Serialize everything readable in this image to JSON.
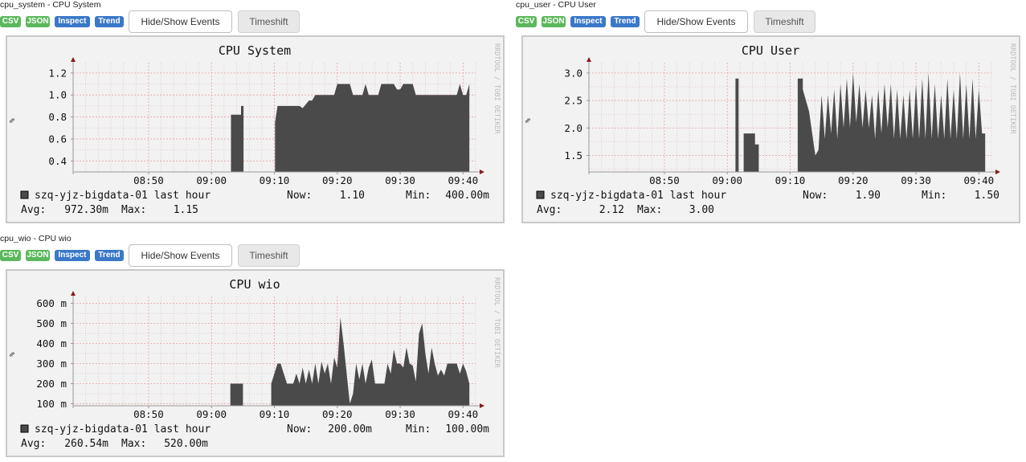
{
  "panels": [
    {
      "header": "cpu_system - CPU System",
      "buttons": {
        "csv": "CSV",
        "json": "JSON",
        "inspect": "Inspect",
        "trend": "Trend",
        "events": "Hide/Show Events",
        "timeshift": "Timeshift"
      },
      "watermark": "RRDTOOL / TOBI OETIKER",
      "legend": {
        "host": "szq-yjz-bigdata-01 last hour",
        "now_label": "Now:",
        "now_value": "1.10",
        "min_label": "Min:",
        "min_value": "400.00m",
        "avg_label": "Avg:",
        "avg_value": "972.30m",
        "max_label": "Max:",
        "max_value": "1.15"
      }
    },
    {
      "header": "cpu_user - CPU User",
      "buttons": {
        "csv": "CSV",
        "json": "JSON",
        "inspect": "Inspect",
        "trend": "Trend",
        "events": "Hide/Show Events",
        "timeshift": "Timeshift"
      },
      "watermark": "RRDTOOL / TOBI OETIKER",
      "legend": {
        "host": "szq-yjz-bigdata-01 last hour",
        "now_label": "Now:",
        "now_value": "1.90",
        "min_label": "Min:",
        "min_value": "1.50",
        "avg_label": "Avg:",
        "avg_value": "2.12",
        "max_label": "Max:",
        "max_value": "3.00"
      }
    },
    {
      "header": "cpu_wio - CPU wio",
      "buttons": {
        "csv": "CSV",
        "json": "JSON",
        "inspect": "Inspect",
        "trend": "Trend",
        "events": "Hide/Show Events",
        "timeshift": "Timeshift"
      },
      "watermark": "RRDTOOL / TOBI OETIKER",
      "legend": {
        "host": "szq-yjz-bigdata-01 last hour",
        "now_label": "Now:",
        "now_value": "200.00m",
        "min_label": "Min:",
        "min_value": "100.00m",
        "avg_label": "Avg:",
        "avg_value": "260.54m",
        "max_label": "Max:",
        "max_value": "520.00m"
      }
    }
  ],
  "colors": {
    "area": "#4a4a4a",
    "grid_minor": "#e4c0c0",
    "grid_major": "#e8a0a0",
    "axis": "#999999",
    "arrow": "#8b1a1a",
    "badge_green": "#5cb85c",
    "badge_blue": "#3a78c8"
  },
  "chart_data": [
    {
      "type": "area",
      "title": "CPU System",
      "ylabel": "%",
      "ylim": [
        0.3,
        1.25
      ],
      "xlim": [
        38,
        102
      ],
      "x_ticks": [
        50,
        60,
        70,
        80,
        90,
        100
      ],
      "x_tick_labels": [
        "08:50",
        "09:00",
        "09:10",
        "09:20",
        "09:30",
        "09:40"
      ],
      "y_ticks": [
        0.4,
        0.6,
        0.8,
        1.0,
        1.2
      ],
      "y_tick_labels": [
        "0.4",
        "0.6",
        "0.8",
        "1.0",
        "1.2"
      ],
      "series": [
        {
          "x": [
            38,
            63.1,
            63.1,
            64.7,
            64.7,
            65.1,
            65.1,
            67.1,
            67.1,
            67.5,
            67.5,
            70.1,
            70.1,
            70.5,
            71,
            71,
            74,
            74.5,
            75.5,
            76,
            76.5,
            77,
            77.5,
            78,
            79.5,
            80,
            82,
            82.5,
            84,
            84.5,
            85,
            85.5,
            86.5,
            87,
            89,
            89.5,
            90,
            90.5,
            92,
            92.5,
            93,
            93.5,
            96,
            96.5,
            98.5,
            99,
            99.5,
            100,
            100.5,
            101,
            101
          ],
          "y": [
            0.3,
            0.3,
            0.82,
            0.82,
            0.9,
            0.9,
            0.3,
            0.3,
            0.3,
            0.3,
            0.3,
            0.3,
            0.75,
            0.9,
            0.9,
            0.9,
            0.9,
            0.88,
            0.95,
            0.95,
            1.0,
            1.0,
            1.0,
            1.0,
            1.0,
            1.1,
            1.1,
            1.0,
            1.0,
            1.1,
            1.0,
            1.0,
            1.0,
            1.1,
            1.1,
            1.05,
            1.05,
            1.1,
            1.1,
            1.0,
            1.0,
            1.0,
            1.0,
            1.0,
            1.0,
            1.0,
            1.1,
            1.0,
            1.0,
            1.1,
            0.3
          ]
        }
      ]
    },
    {
      "type": "area",
      "title": "CPU User",
      "ylabel": "%",
      "ylim": [
        1.2,
        3.1
      ],
      "xlim": [
        38,
        102
      ],
      "x_ticks": [
        50,
        60,
        70,
        80,
        90,
        100
      ],
      "x_tick_labels": [
        "08:50",
        "09:00",
        "09:10",
        "09:20",
        "09:30",
        "09:40"
      ],
      "y_ticks": [
        1.5,
        2.0,
        2.5,
        3.0
      ],
      "y_tick_labels": [
        "1.5",
        "2.0",
        "2.5",
        "3.0"
      ],
      "series": [
        {
          "x": [
            38,
            61.3,
            61.3,
            61.8,
            61.8,
            62.6,
            62.6,
            64.4,
            64.4,
            65,
            65,
            71.2,
            71.2,
            72,
            72,
            73,
            74,
            74.5,
            75,
            75.5,
            76,
            76.5,
            77,
            77.5,
            78,
            78.5,
            79,
            79.5,
            80,
            80.5,
            81,
            81.5,
            82,
            82.5,
            83,
            83.5,
            84,
            84.5,
            85,
            85.5,
            86,
            86.5,
            87,
            87.5,
            88,
            88.5,
            89,
            89.5,
            90,
            90.5,
            91,
            91.5,
            92,
            92.5,
            93,
            93.5,
            94,
            94.5,
            95,
            95.5,
            96,
            96.5,
            97,
            97.5,
            98,
            98.5,
            99,
            99.5,
            100,
            100.5,
            101,
            101
          ],
          "y": [
            1.2,
            1.2,
            2.9,
            2.9,
            1.2,
            1.2,
            1.9,
            1.9,
            1.7,
            1.7,
            1.2,
            1.2,
            2.9,
            2.9,
            2.7,
            2.3,
            1.5,
            1.6,
            2.6,
            1.8,
            2.6,
            1.9,
            2.7,
            1.8,
            2.8,
            2.0,
            2.9,
            2.0,
            3.0,
            2.1,
            2.8,
            2.0,
            2.7,
            2.0,
            2.6,
            1.8,
            2.7,
            1.9,
            2.8,
            2.0,
            2.8,
            1.8,
            2.7,
            1.8,
            2.6,
            1.8,
            2.7,
            1.8,
            2.8,
            1.8,
            2.9,
            1.8,
            3.0,
            1.8,
            2.8,
            1.8,
            2.6,
            1.8,
            2.9,
            1.8,
            2.7,
            1.8,
            3.0,
            1.8,
            2.8,
            1.8,
            2.9,
            1.8,
            2.7,
            1.9,
            1.9,
            1.2
          ]
        }
      ]
    },
    {
      "type": "area",
      "title": "CPU wio",
      "ylabel": "%",
      "ylim": [
        90,
        610
      ],
      "xlim": [
        38,
        102
      ],
      "x_ticks": [
        50,
        60,
        70,
        80,
        90,
        100
      ],
      "x_tick_labels": [
        "08:50",
        "09:00",
        "09:10",
        "09:20",
        "09:30",
        "09:40"
      ],
      "y_ticks": [
        100,
        200,
        300,
        400,
        500,
        600
      ],
      "y_tick_labels": [
        "100 m",
        "200 m",
        "300 m",
        "400 m",
        "500 m",
        "600 m"
      ],
      "series": [
        {
          "x": [
            38,
            63,
            63,
            65,
            65,
            69.5,
            69.5,
            70.5,
            71,
            71.5,
            72,
            72.5,
            73,
            73.5,
            74,
            74.5,
            75,
            75.5,
            76,
            76.5,
            77,
            77.5,
            78,
            78.5,
            79,
            79.5,
            80,
            80.5,
            81,
            81.5,
            82,
            82.5,
            83,
            83.5,
            84,
            84.5,
            85,
            85.5,
            86,
            86.5,
            87,
            87.5,
            88,
            88.5,
            89,
            89.5,
            90,
            90.5,
            91,
            91.5,
            92,
            92.5,
            93,
            93.5,
            94,
            94.5,
            95,
            95.5,
            96,
            96.5,
            97,
            97.5,
            98,
            98.5,
            99,
            99.5,
            100,
            100.5,
            101,
            101
          ],
          "y": [
            90,
            90,
            200,
            200,
            90,
            90,
            200,
            300,
            300,
            250,
            200,
            200,
            200,
            250,
            200,
            280,
            200,
            270,
            200,
            300,
            200,
            310,
            250,
            300,
            200,
            330,
            280,
            530,
            400,
            250,
            100,
            150,
            300,
            220,
            300,
            200,
            280,
            320,
            200,
            200,
            200,
            200,
            300,
            250,
            370,
            300,
            300,
            280,
            380,
            300,
            290,
            210,
            450,
            500,
            350,
            250,
            380,
            300,
            240,
            270,
            240,
            300,
            300,
            300,
            300,
            250,
            300,
            260,
            200,
            90
          ]
        }
      ]
    }
  ]
}
